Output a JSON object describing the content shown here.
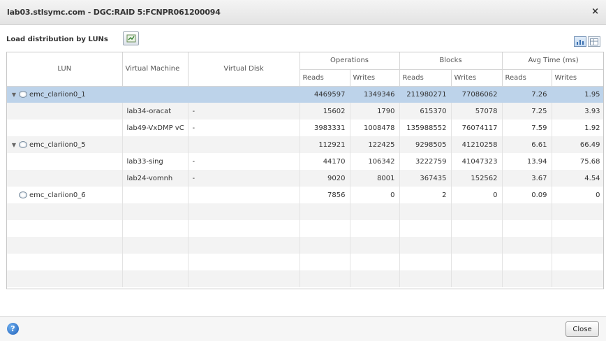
{
  "window": {
    "title": "lab03.stlsymc.com - DGC:RAID 5:FCNPR061200094",
    "close_glyph": "×"
  },
  "section": {
    "title": "Load distribution by LUNs"
  },
  "icons": {
    "refresh": "refresh-icon",
    "view_chart": "chart-view-icon",
    "view_table": "table-view-icon",
    "help": "help-icon",
    "tree_expanded": "▼",
    "disk": "disk-icon"
  },
  "table": {
    "headers": {
      "lun": "LUN",
      "vm": "Virtual Machine",
      "vdisk": "Virtual Disk",
      "operations": "Operations",
      "blocks": "Blocks",
      "avg_time": "Avg Time (ms)",
      "reads": "Reads",
      "writes": "Writes"
    },
    "rows": [
      {
        "lun": "emc_clariion0_1",
        "expanded": true,
        "vm": "",
        "vdisk": "",
        "op_reads": "4469597",
        "op_writes": "1349346",
        "bl_reads": "211980271",
        "bl_writes": "77086062",
        "at_reads": "7.26",
        "at_writes": "1.95"
      },
      {
        "lun": "",
        "vm": "lab34-oracat",
        "vdisk": "-",
        "op_reads": "15602",
        "op_writes": "1790",
        "bl_reads": "615370",
        "bl_writes": "57078",
        "at_reads": "7.25",
        "at_writes": "3.93"
      },
      {
        "lun": "",
        "vm": "lab49-VxDMP vC",
        "vdisk": "-",
        "op_reads": "3983331",
        "op_writes": "1008478",
        "bl_reads": "135988552",
        "bl_writes": "76074117",
        "at_reads": "7.59",
        "at_writes": "1.92"
      },
      {
        "lun": "emc_clariion0_5",
        "expanded": true,
        "vm": "",
        "vdisk": "",
        "op_reads": "112921",
        "op_writes": "122425",
        "bl_reads": "9298505",
        "bl_writes": "41210258",
        "at_reads": "6.61",
        "at_writes": "66.49"
      },
      {
        "lun": "",
        "vm": "lab33-sing",
        "vdisk": "-",
        "op_reads": "44170",
        "op_writes": "106342",
        "bl_reads": "3222759",
        "bl_writes": "41047323",
        "at_reads": "13.94",
        "at_writes": "75.68"
      },
      {
        "lun": "",
        "vm": "lab24-vomnh",
        "vdisk": "-",
        "op_reads": "9020",
        "op_writes": "8001",
        "bl_reads": "367435",
        "bl_writes": "152562",
        "at_reads": "3.67",
        "at_writes": "4.54"
      },
      {
        "lun": "emc_clariion0_6",
        "expanded": false,
        "vm": "",
        "vdisk": "",
        "op_reads": "7856",
        "op_writes": "0",
        "bl_reads": "2",
        "bl_writes": "0",
        "at_reads": "0.09",
        "at_writes": "0"
      }
    ],
    "selected_row": 0
  },
  "footer": {
    "close_label": "Close",
    "help_glyph": "?"
  }
}
